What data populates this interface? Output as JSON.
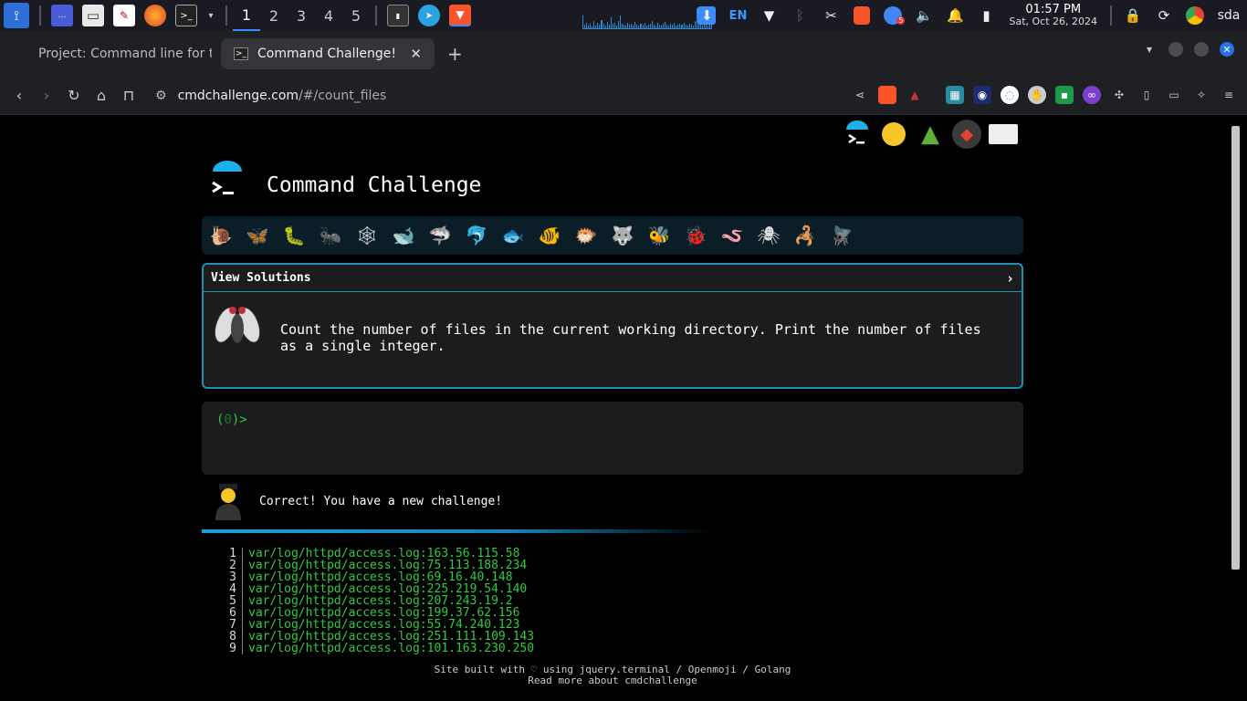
{
  "taskbar": {
    "workspaces": [
      "1",
      "2",
      "3",
      "4",
      "5"
    ],
    "active_workspace": "1",
    "language": "EN",
    "clock_time": "01:57 PM",
    "clock_date": "Sat, Oct 26, 2024",
    "user": "sda",
    "notification_badge": "5"
  },
  "tabs": {
    "inactive_title": "Project: Command line for th",
    "active_title": "Command Challenge!",
    "new_tab": "+"
  },
  "address_bar": {
    "domain": "cmdchallenge.com",
    "path": "/#/count_files"
  },
  "page": {
    "title": "Command Challenge",
    "view_solutions": "View Solutions",
    "chevron": "›",
    "challenge_text": "Count the number of files in the current working directory. Print the number of files as a single integer.",
    "prompt_open": "(",
    "prompt_count": "0",
    "prompt_close": ")>",
    "result_message": "Correct! You have a new challenge!",
    "output_lines": [
      {
        "num": "1",
        "text": "var/log/httpd/access.log:163.56.115.58"
      },
      {
        "num": "2",
        "text": "var/log/httpd/access.log:75.113.188.234"
      },
      {
        "num": "3",
        "text": "var/log/httpd/access.log:69.16.40.148"
      },
      {
        "num": "4",
        "text": "var/log/httpd/access.log:225.219.54.140"
      },
      {
        "num": "5",
        "text": "var/log/httpd/access.log:207.243.19.2"
      },
      {
        "num": "6",
        "text": "var/log/httpd/access.log:199.37.62.156"
      },
      {
        "num": "7",
        "text": "var/log/httpd/access.log:55.74.240.123"
      },
      {
        "num": "8",
        "text": "var/log/httpd/access.log:251.111.109.143"
      },
      {
        "num": "9",
        "text": "var/log/httpd/access.log:101.163.230.250"
      }
    ],
    "footer_line1": "Site built with ♡ using jquery.terminal / Openmoji / Golang",
    "footer_line2": "Read more about cmdchallenge"
  },
  "challenge_icons": [
    "snail-icon",
    "butterfly-icon",
    "caterpillar-icon",
    "ant-icon",
    "spider-web-icon",
    "whale-icon",
    "shark-icon",
    "dolphin-icon",
    "fish-icon",
    "tropical-fish-icon",
    "blowfish-icon",
    "wolf-icon",
    "bee-icon",
    "ladybug-icon",
    "worm-icon",
    "spider-icon",
    "scorpion-icon",
    "fly-icon"
  ],
  "colors": {
    "accent": "#1e8fb5",
    "terminal_green": "#2ecc40",
    "panel_bg": "#1c1c1e",
    "animal_bar_bg": "#0b1d26"
  }
}
